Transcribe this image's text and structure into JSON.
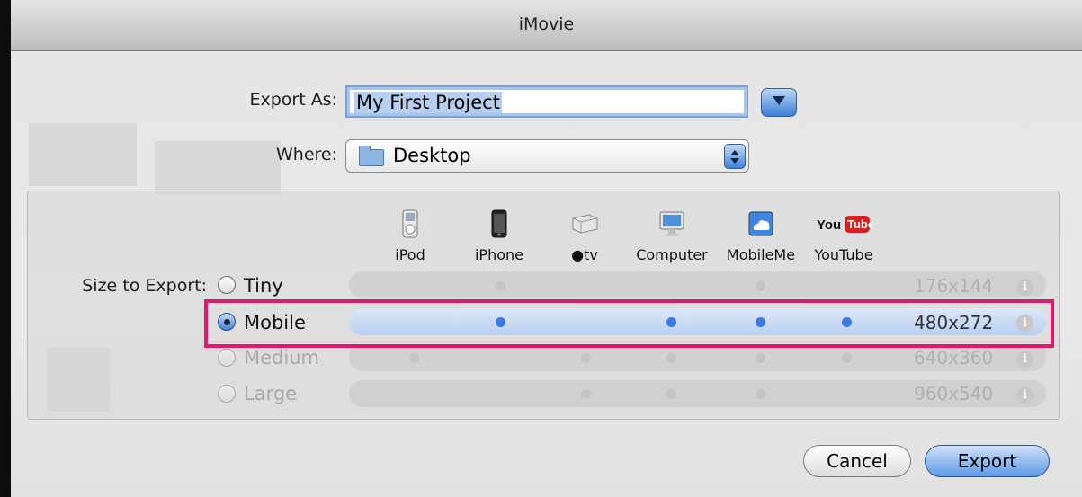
{
  "window": {
    "title": "iMovie"
  },
  "form": {
    "export_as_label": "Export As:",
    "export_as_value": "My First Project",
    "where_label": "Where:",
    "where_value": "Desktop"
  },
  "size": {
    "label": "Size to Export:",
    "devices": [
      {
        "name": "iPod",
        "icon": "ipod-icon"
      },
      {
        "name": "iPhone",
        "icon": "iphone-icon"
      },
      {
        "name": "tv",
        "icon": "apple-tv-icon"
      },
      {
        "name": "Computer",
        "icon": "computer-icon"
      },
      {
        "name": "MobileMe",
        "icon": "mobileme-icon"
      },
      {
        "name": "YouTube",
        "icon": "youtube-icon"
      }
    ],
    "options": [
      {
        "label": "Tiny",
        "resolution": "176x144",
        "selected": false,
        "enabled": true,
        "compatible": [
          false,
          true,
          false,
          false,
          true,
          false
        ]
      },
      {
        "label": "Mobile",
        "resolution": "480x272",
        "selected": true,
        "enabled": true,
        "compatible": [
          false,
          true,
          false,
          true,
          true,
          true
        ]
      },
      {
        "label": "Medium",
        "resolution": "640x360",
        "selected": false,
        "enabled": false,
        "compatible": [
          true,
          false,
          true,
          true,
          true,
          true
        ]
      },
      {
        "label": "Large",
        "resolution": "960x540",
        "selected": false,
        "enabled": false,
        "compatible": [
          false,
          false,
          true,
          true,
          true,
          false
        ]
      }
    ]
  },
  "buttons": {
    "cancel": "Cancel",
    "export": "Export"
  },
  "colors": {
    "highlight": "#e0196b",
    "accent": "#3a79e0"
  }
}
